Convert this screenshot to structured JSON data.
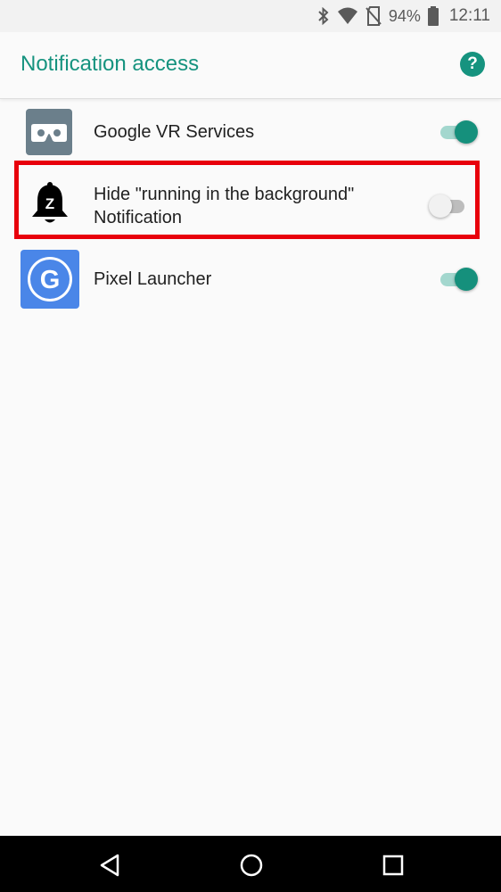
{
  "status_bar": {
    "battery_percent": "94%",
    "time": "12:11",
    "icons": [
      "bluetooth-icon",
      "wifi-icon",
      "no-sim-icon",
      "battery-icon"
    ]
  },
  "app_bar": {
    "title": "Notification access",
    "help_icon": "help-icon",
    "help_glyph": "?"
  },
  "apps": [
    {
      "name": "Google VR Services",
      "icon": "vr-headset-icon",
      "enabled": true
    },
    {
      "name_line1": "Hide \"running in the background\"",
      "name_line2": "Notification",
      "icon": "bell-z-icon",
      "enabled": false,
      "highlighted": true
    },
    {
      "name": "Pixel Launcher",
      "icon": "google-g-icon",
      "enabled": true
    }
  ],
  "nav_bar": {
    "buttons": [
      "back-icon",
      "home-icon",
      "recents-icon"
    ]
  },
  "colors": {
    "accent": "#16937f",
    "highlight_border": "#e8000b"
  }
}
